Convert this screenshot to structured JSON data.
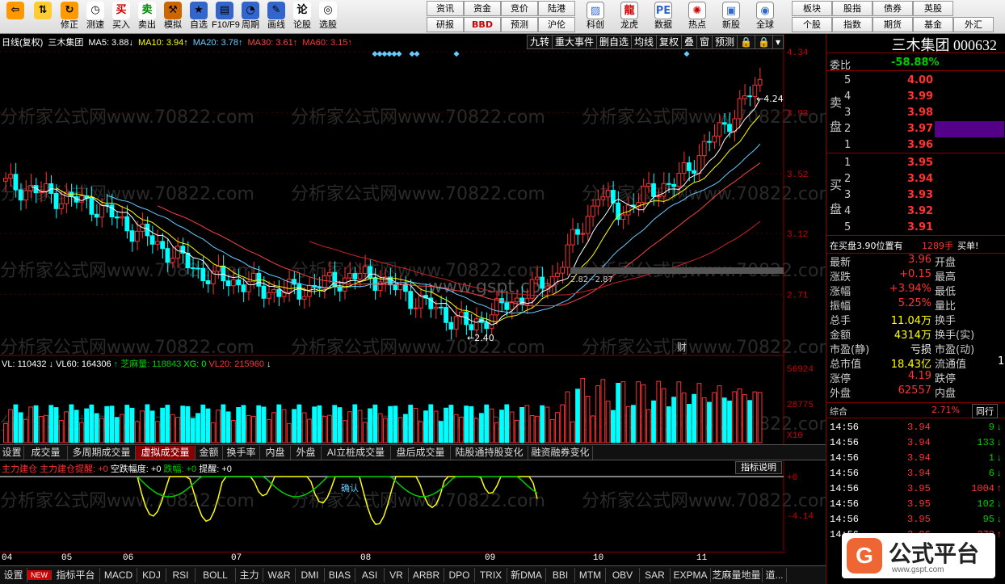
{
  "toolbar": {
    "buttons": [
      {
        "label": "",
        "icon": "back-arrow-icon"
      },
      {
        "label": "",
        "icon": "up-down-arrow-icon"
      },
      {
        "label": "修正",
        "icon": "repair-icon"
      },
      {
        "label": "测速",
        "icon": "speedometer-icon"
      },
      {
        "label": "买入",
        "icon": "buy-icon",
        "glyph": "买"
      },
      {
        "label": "卖出",
        "icon": "sell-icon",
        "glyph": "卖"
      },
      {
        "label": "模拟",
        "icon": "gavel-icon"
      },
      {
        "label": "自选",
        "icon": "star-icon"
      },
      {
        "label": "F10/F9",
        "icon": "info-icon"
      },
      {
        "label": "周期",
        "icon": "clock-icon"
      },
      {
        "label": "画线",
        "icon": "pencil-icon"
      },
      {
        "label": "论股",
        "icon": "chat-icon"
      },
      {
        "label": "选股",
        "icon": "select-icon"
      }
    ],
    "grid": [
      [
        "资讯",
        "资金",
        "竞价",
        "陆港"
      ],
      [
        "研报",
        "BBD",
        "预测",
        "沪伦"
      ]
    ],
    "buttons2": [
      {
        "label": "科创",
        "icon": "chart-icon"
      },
      {
        "label": "龙虎",
        "icon": "dragon-icon"
      },
      {
        "label": "数据",
        "icon": "pe-icon",
        "glyph": "PE"
      },
      {
        "label": "热点",
        "icon": "hot-icon"
      },
      {
        "label": "新股",
        "icon": "new-stock-icon"
      },
      {
        "label": "全球",
        "icon": "globe-icon"
      }
    ],
    "grid2": [
      [
        "板块",
        "股指",
        "债券",
        "英股"
      ],
      [
        "个股",
        "指数",
        "期货",
        "基金",
        "外汇"
      ]
    ]
  },
  "chart": {
    "title": "日线(复权)",
    "stock": "三木集团",
    "ma": [
      {
        "label": "MA5: 3.88",
        "arrow": "↓",
        "color": "#fff"
      },
      {
        "label": "MA10: 3.94",
        "arrow": "↑",
        "color": "#ff0"
      },
      {
        "label": "MA20: 3.78",
        "arrow": "↑",
        "color": "#6cf"
      },
      {
        "label": "MA30: 3.61",
        "arrow": "↑",
        "color": "#f44"
      },
      {
        "label": "MA60: 3.15",
        "arrow": "↑",
        "color": "#f33"
      }
    ],
    "top_buttons": [
      "九转",
      "重大事件",
      "删自选",
      "均线",
      "复权",
      "叠",
      "窗",
      "预测",
      "🔒",
      "🔒",
      "▾"
    ],
    "price_ticks": [
      "4.34",
      "3.93",
      "3.52",
      "3.12",
      "2.71"
    ],
    "annotations": {
      "high": "4.24",
      "low": "2.40",
      "range": "2.82~2.87",
      "finance": "财"
    },
    "vol_legend": [
      {
        "text": "VL: 110432",
        "color": "#fff"
      },
      {
        "text": "↓ VL60: 164306",
        "color": "#fff"
      },
      {
        "text": "↑ 芝麻量: 118843",
        "color": "#0c0"
      },
      {
        "text": "XG: 0",
        "color": "#0f0"
      },
      {
        "text": "VL20: 215960",
        "color": "#f33"
      },
      {
        "text": "↓",
        "color": "#fff"
      }
    ],
    "vol_ticks": [
      "56924",
      "28775",
      "X10"
    ],
    "tabs": [
      "设置",
      "成交量",
      "多周期成交量",
      "虚拟成交量",
      "金额",
      "换手率",
      "内盘",
      "外盘",
      "AI立桩成交量",
      "盘后成交量",
      "陆股通持股变化",
      "融资融券变化"
    ],
    "active_tab": "虚拟成交量",
    "ind_legend": [
      {
        "text": "主力建仓",
        "color": "#f33"
      },
      {
        "text": "主力建仓提醒: +0",
        "color": "#f33"
      },
      {
        "text": "空跌幅度: +0",
        "color": "#fff"
      },
      {
        "text": "跌幅: +0",
        "color": "#0c0"
      },
      {
        "text": "提醒: +0",
        "color": "#fff"
      }
    ],
    "ind_btn": "指标说明",
    "ind_ticks": [
      "+0",
      "-4.14"
    ],
    "ind_note": "确认",
    "dates": [
      "04",
      "05",
      "06",
      "07",
      "08",
      "09",
      "10",
      "11"
    ],
    "bottom": [
      "设置",
      "NEW",
      "指标平台",
      "MACD",
      "KDJ",
      "RSI",
      "BOLL",
      "主力",
      "W&R",
      "DMI",
      "BIAS",
      "ASI",
      "VR",
      "ARBR",
      "DPO",
      "TRIX",
      "新DMA",
      "BBI",
      "MTM",
      "OBV",
      "SAR",
      "EXPMA",
      "芝麻量地量",
      "道..."
    ],
    "watermark_text": "www.gspt.com"
  },
  "panel": {
    "name": "三木集团",
    "code": "000632",
    "weibi_label": "委比",
    "weibi": "-58.88%",
    "sell_label": [
      "卖",
      "盘"
    ],
    "sells": [
      [
        "5",
        "4.00"
      ],
      [
        "4",
        "3.99"
      ],
      [
        "3",
        "3.98"
      ],
      [
        "2",
        "3.97"
      ],
      [
        "1",
        "3.96"
      ]
    ],
    "buy_label": [
      "买",
      "盘"
    ],
    "buys": [
      [
        "1",
        "3.95"
      ],
      [
        "2",
        "3.94"
      ],
      [
        "3",
        "3.93"
      ],
      [
        "4",
        "3.92"
      ],
      [
        "5",
        "3.91"
      ]
    ],
    "notice": "在买盘3.90位置有",
    "notice_qty": "1289手",
    "notice_act": "买单!",
    "stats": [
      [
        "最新",
        "3.96",
        "开盘",
        ""
      ],
      [
        "涨跌",
        "+0.15",
        "最高",
        ""
      ],
      [
        "涨幅",
        "+3.94%",
        "最低",
        ""
      ],
      [
        "振幅",
        "5.25%",
        "量比",
        ""
      ],
      [
        "总手",
        "11.04万",
        "换手",
        ""
      ],
      [
        "金额",
        "4314万",
        "换手(实)",
        ""
      ],
      [
        "市盈(静)",
        "亏损",
        "市盈(动)",
        ""
      ],
      [
        "总市值",
        "18.43亿",
        "流通值",
        "1"
      ],
      [
        "涨停",
        "4.19",
        "跌停",
        ""
      ],
      [
        "外盘",
        "62557",
        "内盘",
        ""
      ]
    ],
    "section": "综合",
    "section_pct": "2.71%",
    "section_btn": "同行",
    "trades": [
      [
        "14:56",
        "3.94",
        "9",
        "↓"
      ],
      [
        "14:56",
        "3.94",
        "133",
        "↓"
      ],
      [
        "14:56",
        "3.94",
        "1",
        "↓"
      ],
      [
        "14:56",
        "3.94",
        "6",
        "↓"
      ],
      [
        "14:56",
        "3.95",
        "1004",
        "↑"
      ],
      [
        "14:56",
        "3.95",
        "102",
        "↓"
      ],
      [
        "14:56",
        "3.95",
        "95",
        "↓"
      ],
      [
        "14:56",
        "3.96",
        "270",
        "↑"
      ]
    ],
    "logo_text": "公式平台",
    "logo_sub": "www.gspt.com"
  }
}
